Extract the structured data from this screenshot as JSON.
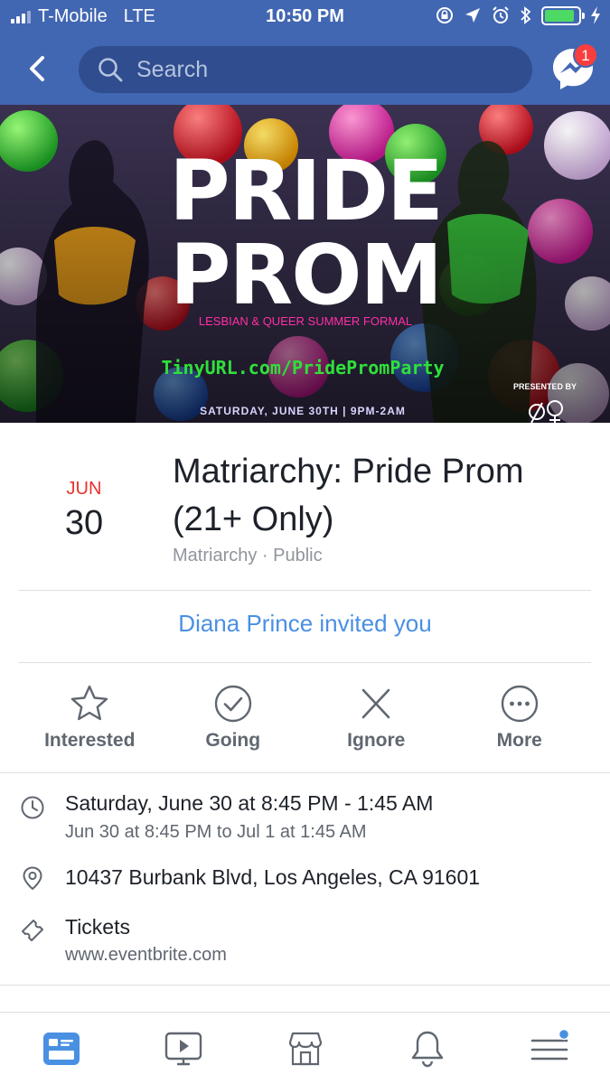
{
  "status_bar": {
    "carrier": "T-Mobile",
    "network": "LTE",
    "time": "10:50 PM",
    "battery_level": 0.9,
    "battery_color": "#4cd964"
  },
  "nav": {
    "search_placeholder": "Search",
    "messenger_badge": "1",
    "bar_color": "#4267b2"
  },
  "cover": {
    "title_line1": "PRIDE",
    "title_line2": "PROM",
    "tagline": "LESBIAN & QUEER SUMMER FORMAL",
    "url": "TinyURL.com/PridePromParty",
    "date_line": "SATURDAY, JUNE 30TH | 9PM-2AM",
    "presented_by": "PRESENTED BY"
  },
  "event": {
    "month": "JUN",
    "day": "30",
    "title": "Matriarchy: Pride Prom (21+ Only)",
    "host": "Matriarchy",
    "visibility": "Public",
    "separator": "·",
    "invite_text": "Diana Prince invited you"
  },
  "actions": [
    {
      "label": "Interested",
      "icon": "star-icon"
    },
    {
      "label": "Going",
      "icon": "check-circle-icon"
    },
    {
      "label": "Ignore",
      "icon": "x-icon"
    },
    {
      "label": "More",
      "icon": "more-icon"
    }
  ],
  "details": {
    "time_main": "Saturday, June 30 at 8:45 PM - 1:45 AM",
    "time_sub": "Jun 30 at 8:45 PM to Jul 1 at 1:45 AM",
    "address": "10437 Burbank Blvd, Los Angeles, CA 91601",
    "tickets_label": "Tickets",
    "tickets_site": "www.eventbrite.com"
  },
  "tabs": [
    {
      "name": "news-feed",
      "icon": "news-feed-icon",
      "active": true
    },
    {
      "name": "watch",
      "icon": "video-icon",
      "active": false
    },
    {
      "name": "marketplace",
      "icon": "shop-icon",
      "active": false
    },
    {
      "name": "notifications",
      "icon": "bell-icon",
      "active": false
    },
    {
      "name": "menu",
      "icon": "menu-icon",
      "active": false
    }
  ],
  "colors": {
    "accent": "#4a90e2",
    "date_red": "#e9322d",
    "active_tab": "#4a90e2"
  }
}
